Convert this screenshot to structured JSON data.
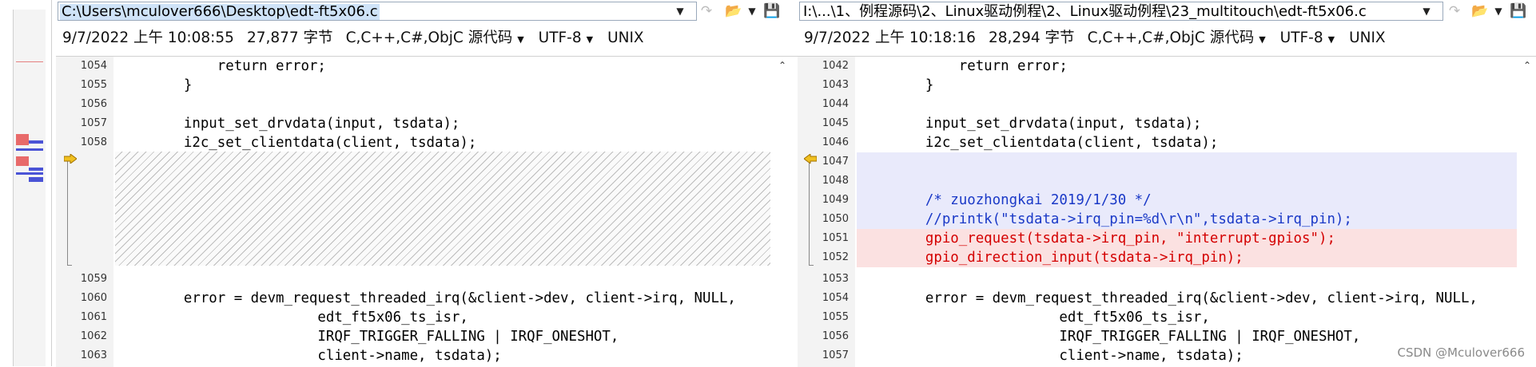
{
  "left": {
    "path": "C:\\Users\\mculover666\\Desktop\\edt-ft5x06.c",
    "date": "9/7/2022 上午 10:08:55",
    "size": "27,877 字节",
    "lang": "C,C++,C#,ObjC 源代码",
    "encoding": "UTF-8",
    "eol": "UNIX",
    "nums": [
      "1054",
      "1055",
      "1056",
      "1057",
      "1058",
      "1059",
      "1060",
      "1061",
      "1062",
      "1063"
    ],
    "lines": [
      "        return error;",
      "    }",
      "",
      "    input_set_drvdata(input, tsdata);",
      "    i2c_set_clientdata(client, tsdata);",
      "",
      "    error = devm_request_threaded_irq(&client->dev, client->irq, NULL,",
      "                    edt_ft5x06_ts_isr,",
      "                    IRQF_TRIGGER_FALLING | IRQF_ONESHOT,",
      "                    client->name, tsdata);"
    ]
  },
  "right": {
    "path": "I:\\...\\1、例程源码\\2、Linux驱动例程\\2、Linux驱动例程\\23_multitouch\\edt-ft5x06.c",
    "date": "9/7/2022 上午 10:18:16",
    "size": "28,294 字节",
    "lang": "C,C++,C#,ObjC 源代码",
    "encoding": "UTF-8",
    "eol": "UNIX",
    "nums": [
      "1042",
      "1043",
      "1044",
      "1045",
      "1046",
      "1047",
      "1048",
      "1049",
      "1050",
      "1051",
      "1052",
      "1053",
      "1054",
      "1055",
      "1056",
      "1057"
    ],
    "lines": [
      "        return error;",
      "    }",
      "",
      "    input_set_drvdata(input, tsdata);",
      "    i2c_set_clientdata(client, tsdata);",
      "",
      "",
      "    /* zuozhongkai 2019/1/30 */",
      "    //printk(\"tsdata->irq_pin=%d\\r\\n\",tsdata->irq_pin);",
      "    gpio_request(tsdata->irq_pin, \"interrupt-gpios\");",
      "    gpio_direction_input(tsdata->irq_pin);",
      "",
      "    error = devm_request_threaded_irq(&client->dev, client->irq, NULL,",
      "                    edt_ft5x06_ts_isr,",
      "                    IRQF_TRIGGER_FALLING | IRQF_ONESHOT,",
      "                    client->name, tsdata);"
    ]
  },
  "watermark": "CSDN @Mculover666",
  "colors": {
    "added": "#e9eafb",
    "changed": "#fbe1e1",
    "comment": "#1a39c7",
    "changed_text": "#d40000"
  }
}
